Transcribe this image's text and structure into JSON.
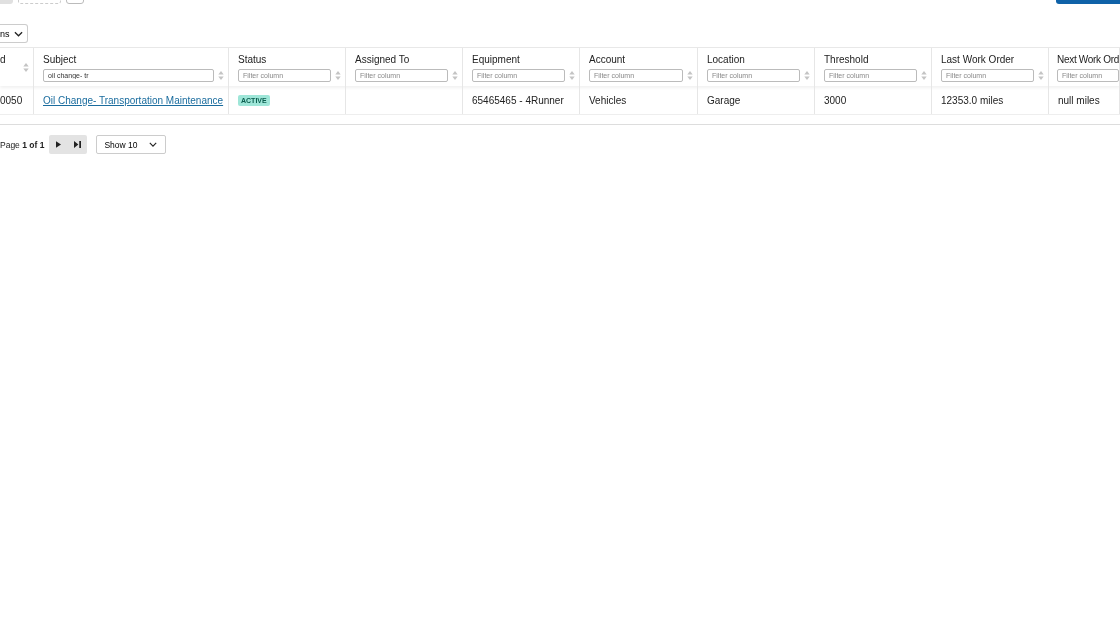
{
  "toolbar": {
    "buttons": [
      {
        "kind": "gray"
      },
      {
        "kind": "dashed"
      },
      {
        "kind": "outline"
      },
      {
        "kind": "primary"
      }
    ]
  },
  "columns_menu": {
    "label": "ns"
  },
  "table": {
    "columns": [
      {
        "label": "d",
        "sortable": true
      },
      {
        "label": "Subject",
        "sortable": true,
        "filter": {
          "value": "oil change- tr"
        }
      },
      {
        "label": "Status",
        "sortable": true,
        "filter": {
          "placeholder": "Filter column"
        }
      },
      {
        "label": "Assigned To",
        "sortable": true,
        "filter": {
          "placeholder": "Filter column"
        }
      },
      {
        "label": "Equipment",
        "sortable": true,
        "filter": {
          "placeholder": "Filter column"
        }
      },
      {
        "label": "Account",
        "sortable": true,
        "filter": {
          "placeholder": "Filter column"
        }
      },
      {
        "label": "Location",
        "sortable": true,
        "filter": {
          "placeholder": "Filter column"
        }
      },
      {
        "label": "Threshold",
        "sortable": true,
        "filter": {
          "placeholder": "Filter column"
        }
      },
      {
        "label": "Last Work Order",
        "sortable": true,
        "filter": {
          "placeholder": "Filter column"
        }
      },
      {
        "label": "Next Work Ord",
        "sortable": false,
        "filter": {
          "placeholder": "Filter column"
        }
      }
    ],
    "rows": [
      {
        "cells": [
          {
            "kind": "text",
            "text": "0050"
          },
          {
            "kind": "link",
            "text": "Oil Change- Transportation Maintenance"
          },
          {
            "kind": "badge",
            "text": "ACTIVE"
          },
          {
            "kind": "empty"
          },
          {
            "kind": "text",
            "text": "65465465 - 4Runner"
          },
          {
            "kind": "text",
            "text": "Vehicles"
          },
          {
            "kind": "text",
            "text": "Garage"
          },
          {
            "kind": "text",
            "text": "3000"
          },
          {
            "kind": "text",
            "text": "12353.0 miles"
          },
          {
            "kind": "text",
            "text": "null miles"
          }
        ]
      }
    ]
  },
  "pager": {
    "label": "Page **1 of 1**",
    "next_disabled": false,
    "last_disabled": false,
    "page_size": "Show 10"
  }
}
